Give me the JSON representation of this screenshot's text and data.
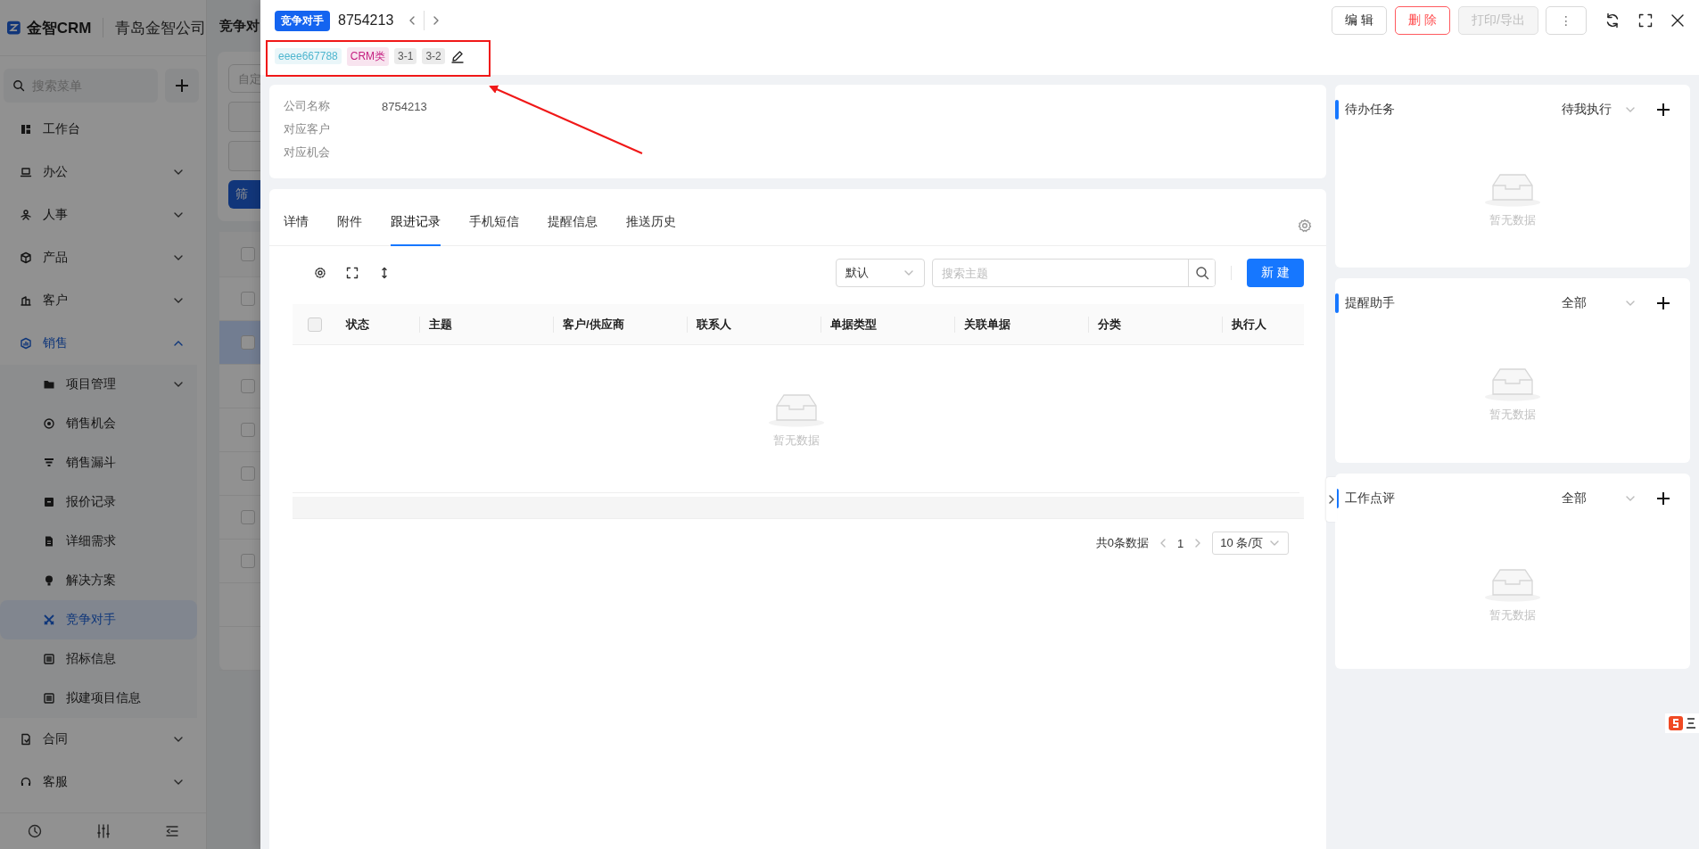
{
  "sidebar": {
    "brand": "金智CRM",
    "company": "青岛金智公司",
    "search": {
      "placeholder": "搜索菜单"
    },
    "items": [
      {
        "label": "工作台",
        "selected": false
      },
      {
        "label": "办公",
        "selected": false,
        "expanded": false
      },
      {
        "label": "人事",
        "selected": false,
        "expanded": false
      },
      {
        "label": "产品",
        "selected": false,
        "expanded": false
      },
      {
        "label": "客户",
        "selected": false,
        "expanded": false
      },
      {
        "label": "销售",
        "selected": false,
        "expanded": true,
        "children": [
          {
            "label": "项目管理",
            "selected": false,
            "expanded": false
          },
          {
            "label": "销售机会",
            "selected": false
          },
          {
            "label": "销售漏斗",
            "selected": false
          },
          {
            "label": "报价记录",
            "selected": false
          },
          {
            "label": "详细需求",
            "selected": false
          },
          {
            "label": "解决方案",
            "selected": false
          },
          {
            "label": "竞争对手",
            "selected": true
          },
          {
            "label": "招标信息",
            "selected": false
          },
          {
            "label": "拟建项目信息",
            "selected": false
          }
        ]
      },
      {
        "label": "合同",
        "selected": false,
        "expanded": false
      },
      {
        "label": "客服",
        "selected": false,
        "expanded": false
      }
    ]
  },
  "background_page": {
    "title": "竞争对",
    "filter": {
      "placeholder": "自定"
    },
    "filter_button": "筛",
    "header_checked": false,
    "rows": [
      {
        "selected": false
      },
      {
        "selected": true
      },
      {
        "selected": false
      },
      {
        "selected": false
      },
      {
        "selected": false
      },
      {
        "selected": false
      },
      {
        "selected": false
      }
    ]
  },
  "drawer": {
    "type_tag": "竞争对手",
    "title": "8754213",
    "buttons": [
      {
        "label": "编 辑",
        "kind": "default",
        "disabled": false
      },
      {
        "label": "删 除",
        "kind": "danger",
        "disabled": false
      },
      {
        "label": "打印/导出",
        "kind": "default",
        "disabled": true
      },
      {
        "label": "⋮",
        "kind": "more",
        "disabled": false
      }
    ],
    "tags": [
      {
        "label": "eeee667788",
        "color": "#4fb6cf"
      },
      {
        "label": "CRM类",
        "color": "#c41d7f"
      },
      {
        "label": "3-1",
        "color": "#595959"
      },
      {
        "label": "3-2",
        "color": "#595959"
      }
    ],
    "fields": [
      {
        "label": "公司名称",
        "value": "8754213"
      },
      {
        "label": "对应客户"
      },
      {
        "label": "对应机会"
      }
    ],
    "tabs": [
      {
        "label": "详情",
        "selected": false
      },
      {
        "label": "附件",
        "selected": false
      },
      {
        "label": "跟进记录",
        "selected": true
      },
      {
        "label": "手机短信",
        "selected": false
      },
      {
        "label": "提醒信息",
        "selected": false
      },
      {
        "label": "推送历史",
        "selected": false
      }
    ],
    "sort_select": "默认",
    "search": {
      "placeholder": "搜索主题"
    },
    "new_button": "新 建",
    "table": {
      "header_checked": false,
      "columns": [
        "状态",
        "主题",
        "客户/供应商",
        "联系人",
        "单据类型",
        "关联单据",
        "分类",
        "执行人"
      ],
      "empty_text": "暂无数据"
    },
    "pagination": {
      "total": "共0条数据",
      "page": "1",
      "page_size": "10 条/页"
    },
    "panels": [
      {
        "title": "待办任务",
        "filter": "待我执行",
        "empty_text": "暂无数据"
      },
      {
        "title": "提醒助手",
        "filter": "全部",
        "empty_text": "暂无数据"
      },
      {
        "title": "工作点评",
        "filter": "全部",
        "empty_text": "暂无数据"
      }
    ]
  }
}
